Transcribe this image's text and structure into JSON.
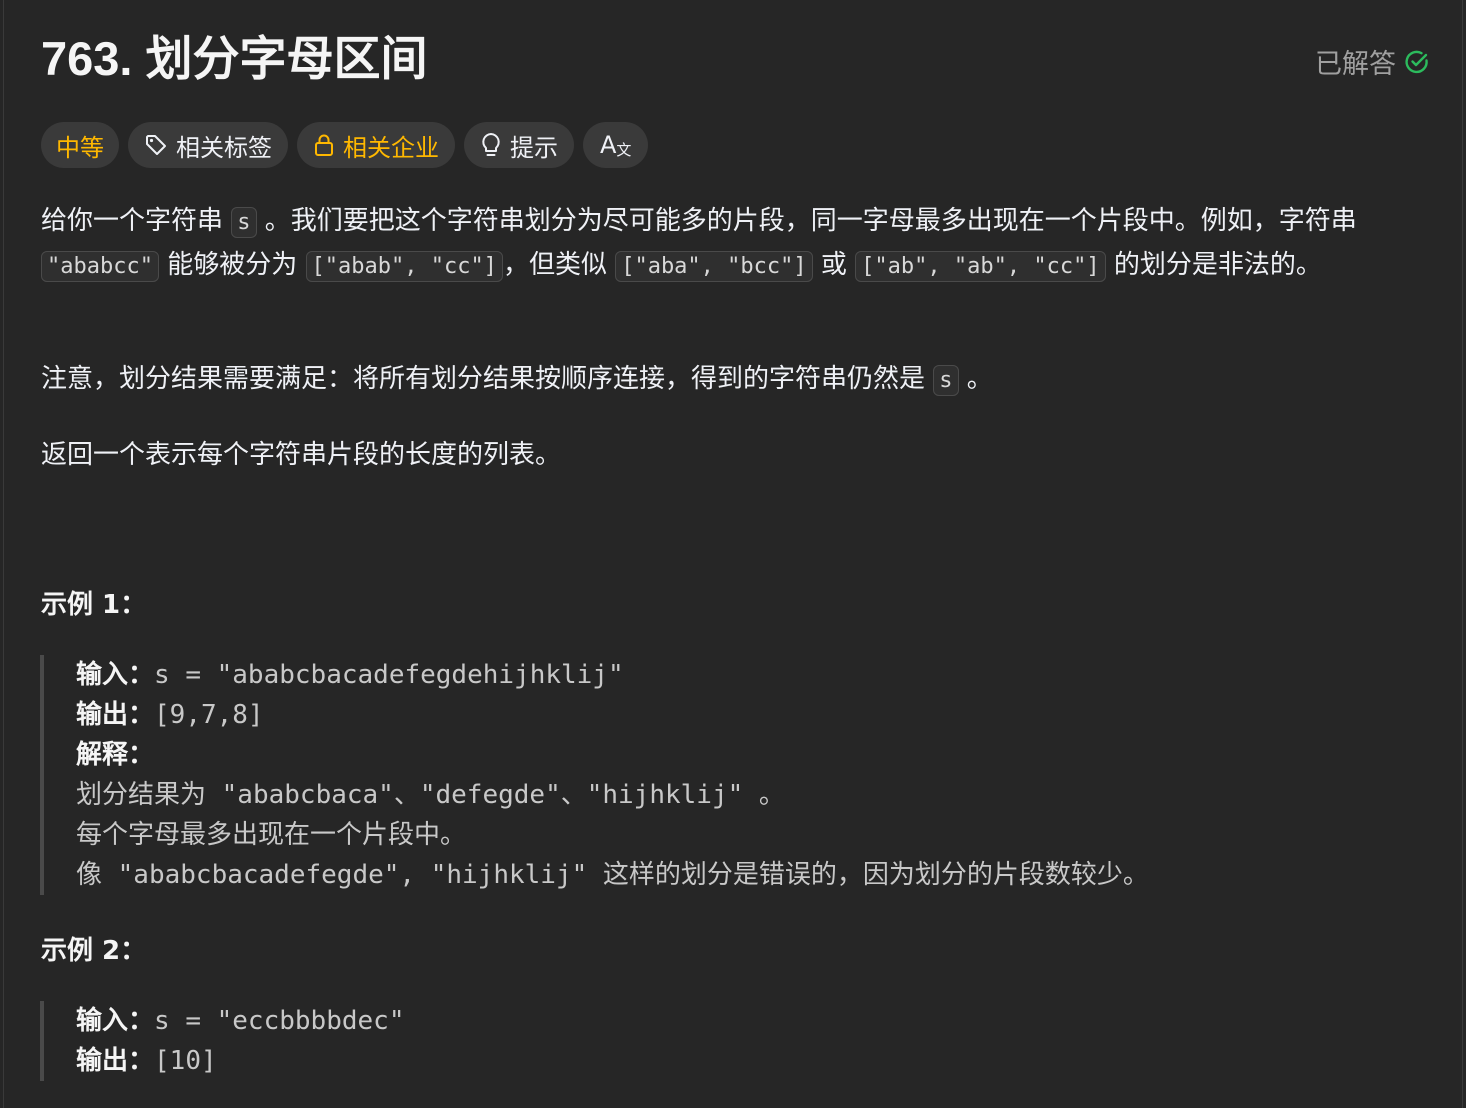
{
  "header": {
    "title": "763. 划分字母区间",
    "status": "已解答",
    "status_color": "#2cbb5d"
  },
  "tags": {
    "difficulty": "中等",
    "topics": "相关标签",
    "companies": "相关企业",
    "hints": "提示",
    "translate": "A"
  },
  "description": {
    "p1_a": "给你一个字符串 ",
    "p1_code1": "s",
    "p1_b": " 。我们要把这个字符串划分为尽可能多的片段，同一字母最多出现在一个片段中。例如，字符串 ",
    "p1_code2": "\"ababcc\"",
    "p1_c": " 能够被分为 ",
    "p1_code3": "[\"abab\", \"cc\"]",
    "p1_d": "，但类似 ",
    "p1_code4": "[\"aba\", \"bcc\"]",
    "p1_e": " 或 ",
    "p1_code5": "[\"ab\", \"ab\", \"cc\"]",
    "p1_f": " 的划分是非法的。",
    "p2_a": "注意，划分结果需要满足：将所有划分结果按顺序连接，得到的字符串仍然是 ",
    "p2_code": "s",
    "p2_b": " 。",
    "p3": "返回一个表示每个字符串片段的长度的列表。"
  },
  "examples": [
    {
      "title": "示例 1：",
      "input_label": "输入：",
      "input": "s = \"ababcbacadefegdehijhklij\"",
      "output_label": "输出：",
      "output": "[9,7,8]",
      "explain_label": "解释：",
      "explain_lines": [
        "划分结果为 \"ababcbaca\"、\"defegde\"、\"hijhklij\" 。",
        "每个字母最多出现在一个片段中。",
        "像 \"ababcbacadefegde\", \"hijhklij\" 这样的划分是错误的，因为划分的片段数较少。"
      ]
    },
    {
      "title": "示例 2：",
      "input_label": "输入：",
      "input": "s = \"eccbbbbdec\"",
      "output_label": "输出：",
      "output": "[10]"
    }
  ]
}
